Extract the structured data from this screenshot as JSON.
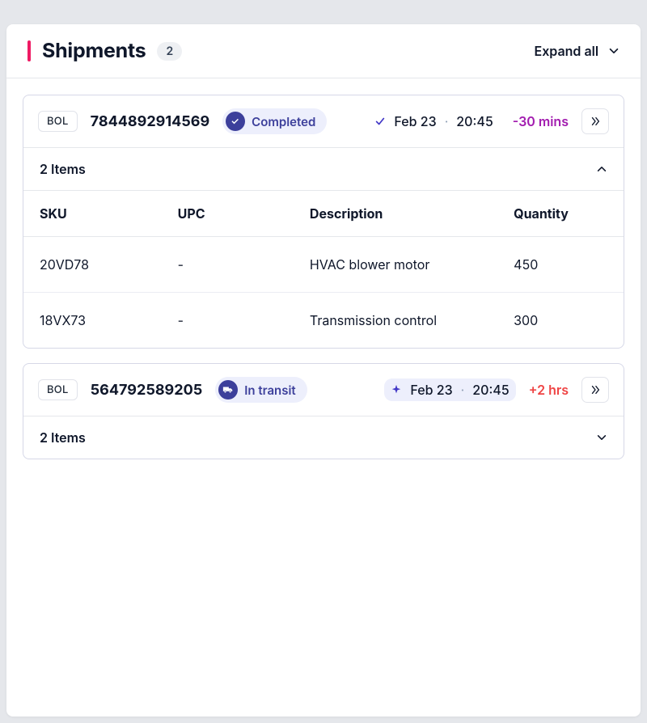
{
  "header": {
    "title": "Shipments",
    "count": "2",
    "expand_all": "Expand all"
  },
  "table_headers": {
    "sku": "SKU",
    "upc": "UPC",
    "description": "Description",
    "quantity": "Quantity"
  },
  "shipments": [
    {
      "bol_label": "BOL",
      "bol_number": "7844892914569",
      "status": "Completed",
      "eta_date": "Feb 23",
      "eta_time": "20:45",
      "delta": "-30 mins",
      "items_label": "2 Items",
      "rows": [
        {
          "sku": "20VD78",
          "upc": "-",
          "description": "HVAC blower motor",
          "quantity": "450"
        },
        {
          "sku": "18VX73",
          "upc": "-",
          "description": "Transmission control",
          "quantity": "300"
        }
      ]
    },
    {
      "bol_label": "BOL",
      "bol_number": "564792589205",
      "status": "In transit",
      "eta_date": "Feb 23",
      "eta_time": "20:45",
      "delta": "+2 hrs",
      "items_label": "2 Items"
    }
  ]
}
